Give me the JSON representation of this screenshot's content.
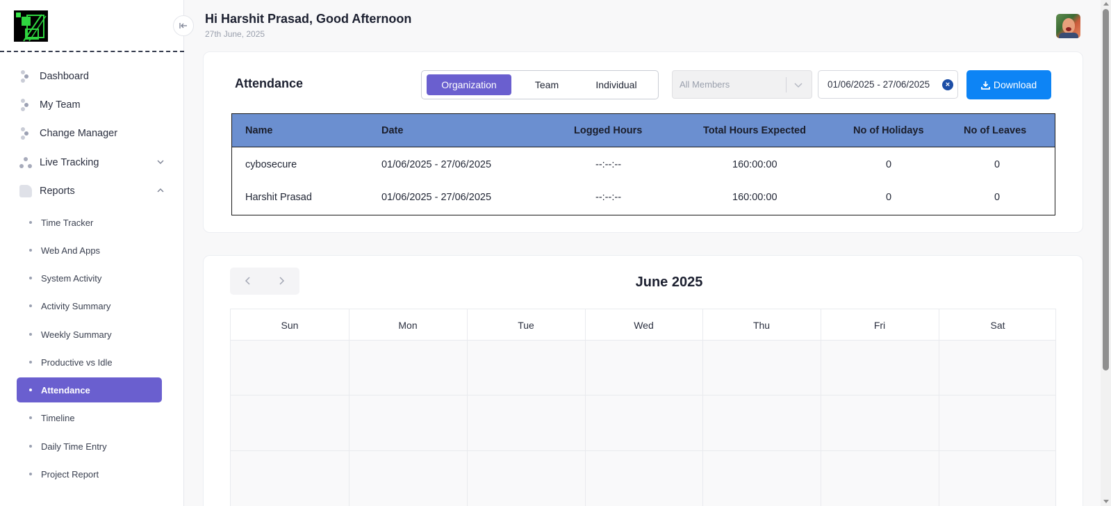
{
  "header": {
    "greeting": "Hi Harshit Prasad, Good Afternoon",
    "date": "27th June, 2025",
    "avatar_icon": "user-avatar"
  },
  "sidebar": {
    "logo_icon": "app-logo",
    "collapse_icon": "arrow-left-bar-icon",
    "items": [
      {
        "label": "Dashboard",
        "icon": "people-icon"
      },
      {
        "label": "My Team",
        "icon": "people-icon"
      },
      {
        "label": "Change Manager",
        "icon": "people-icon"
      },
      {
        "label": "Live Tracking",
        "icon": "tracking-icon",
        "expandable": true,
        "expanded": false
      },
      {
        "label": "Reports",
        "icon": "document-icon",
        "expandable": true,
        "expanded": true
      }
    ],
    "subitems": [
      {
        "label": "Time Tracker"
      },
      {
        "label": "Web And Apps"
      },
      {
        "label": "System Activity"
      },
      {
        "label": "Activity Summary"
      },
      {
        "label": "Weekly Summary"
      },
      {
        "label": "Productive vs Idle"
      },
      {
        "label": "Attendance",
        "active": true
      },
      {
        "label": "Timeline"
      },
      {
        "label": "Daily Time Entry"
      },
      {
        "label": "Project Report"
      }
    ],
    "active_color": "#6a5fcf"
  },
  "attendance": {
    "title": "Attendance",
    "segments": [
      "Organization",
      "Team",
      "Individual"
    ],
    "active_segment": "Organization",
    "members_placeholder": "All Members",
    "date_range": "01/06/2025 - 27/06/2025",
    "download_label": "Download",
    "table": {
      "columns": [
        "Name",
        "Date",
        "Logged Hours",
        "Total Hours Expected",
        "No of Holidays",
        "No of Leaves"
      ],
      "rows": [
        [
          "cybosecure",
          "01/06/2025 - 27/06/2025",
          "--:--:--",
          "160:00:00",
          "0",
          "0"
        ],
        [
          "Harshit Prasad",
          "01/06/2025 - 27/06/2025",
          "--:--:--",
          "160:00:00",
          "0",
          "0"
        ]
      ],
      "header_color": "#6b8fd0"
    }
  },
  "calendar": {
    "title": "June 2025",
    "weekdays": [
      "Sun",
      "Mon",
      "Tue",
      "Wed",
      "Thu",
      "Fri",
      "Sat"
    ]
  },
  "colors": {
    "accent": "#6a5fcf",
    "download": "#0d84f5"
  }
}
